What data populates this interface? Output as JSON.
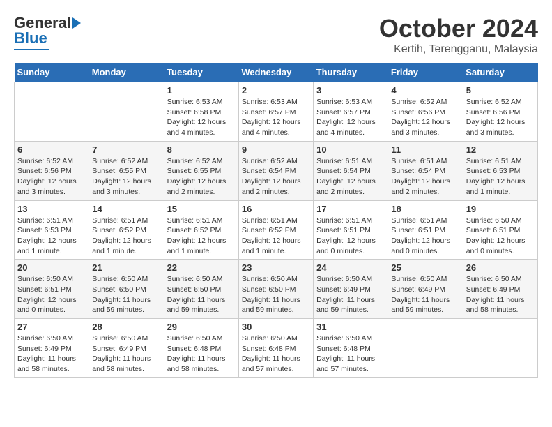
{
  "logo": {
    "line1": "General",
    "line2": "Blue"
  },
  "title": "October 2024",
  "location": "Kertih, Terengganu, Malaysia",
  "days_of_week": [
    "Sunday",
    "Monday",
    "Tuesday",
    "Wednesday",
    "Thursday",
    "Friday",
    "Saturday"
  ],
  "weeks": [
    [
      {
        "day": "",
        "info": ""
      },
      {
        "day": "",
        "info": ""
      },
      {
        "day": "1",
        "info": "Sunrise: 6:53 AM\nSunset: 6:58 PM\nDaylight: 12 hours\nand 4 minutes."
      },
      {
        "day": "2",
        "info": "Sunrise: 6:53 AM\nSunset: 6:57 PM\nDaylight: 12 hours\nand 4 minutes."
      },
      {
        "day": "3",
        "info": "Sunrise: 6:53 AM\nSunset: 6:57 PM\nDaylight: 12 hours\nand 4 minutes."
      },
      {
        "day": "4",
        "info": "Sunrise: 6:52 AM\nSunset: 6:56 PM\nDaylight: 12 hours\nand 3 minutes."
      },
      {
        "day": "5",
        "info": "Sunrise: 6:52 AM\nSunset: 6:56 PM\nDaylight: 12 hours\nand 3 minutes."
      }
    ],
    [
      {
        "day": "6",
        "info": "Sunrise: 6:52 AM\nSunset: 6:56 PM\nDaylight: 12 hours\nand 3 minutes."
      },
      {
        "day": "7",
        "info": "Sunrise: 6:52 AM\nSunset: 6:55 PM\nDaylight: 12 hours\nand 3 minutes."
      },
      {
        "day": "8",
        "info": "Sunrise: 6:52 AM\nSunset: 6:55 PM\nDaylight: 12 hours\nand 2 minutes."
      },
      {
        "day": "9",
        "info": "Sunrise: 6:52 AM\nSunset: 6:54 PM\nDaylight: 12 hours\nand 2 minutes."
      },
      {
        "day": "10",
        "info": "Sunrise: 6:51 AM\nSunset: 6:54 PM\nDaylight: 12 hours\nand 2 minutes."
      },
      {
        "day": "11",
        "info": "Sunrise: 6:51 AM\nSunset: 6:54 PM\nDaylight: 12 hours\nand 2 minutes."
      },
      {
        "day": "12",
        "info": "Sunrise: 6:51 AM\nSunset: 6:53 PM\nDaylight: 12 hours\nand 1 minute."
      }
    ],
    [
      {
        "day": "13",
        "info": "Sunrise: 6:51 AM\nSunset: 6:53 PM\nDaylight: 12 hours\nand 1 minute."
      },
      {
        "day": "14",
        "info": "Sunrise: 6:51 AM\nSunset: 6:52 PM\nDaylight: 12 hours\nand 1 minute."
      },
      {
        "day": "15",
        "info": "Sunrise: 6:51 AM\nSunset: 6:52 PM\nDaylight: 12 hours\nand 1 minute."
      },
      {
        "day": "16",
        "info": "Sunrise: 6:51 AM\nSunset: 6:52 PM\nDaylight: 12 hours\nand 1 minute."
      },
      {
        "day": "17",
        "info": "Sunrise: 6:51 AM\nSunset: 6:51 PM\nDaylight: 12 hours\nand 0 minutes."
      },
      {
        "day": "18",
        "info": "Sunrise: 6:51 AM\nSunset: 6:51 PM\nDaylight: 12 hours\nand 0 minutes."
      },
      {
        "day": "19",
        "info": "Sunrise: 6:50 AM\nSunset: 6:51 PM\nDaylight: 12 hours\nand 0 minutes."
      }
    ],
    [
      {
        "day": "20",
        "info": "Sunrise: 6:50 AM\nSunset: 6:51 PM\nDaylight: 12 hours\nand 0 minutes."
      },
      {
        "day": "21",
        "info": "Sunrise: 6:50 AM\nSunset: 6:50 PM\nDaylight: 11 hours\nand 59 minutes."
      },
      {
        "day": "22",
        "info": "Sunrise: 6:50 AM\nSunset: 6:50 PM\nDaylight: 11 hours\nand 59 minutes."
      },
      {
        "day": "23",
        "info": "Sunrise: 6:50 AM\nSunset: 6:50 PM\nDaylight: 11 hours\nand 59 minutes."
      },
      {
        "day": "24",
        "info": "Sunrise: 6:50 AM\nSunset: 6:49 PM\nDaylight: 11 hours\nand 59 minutes."
      },
      {
        "day": "25",
        "info": "Sunrise: 6:50 AM\nSunset: 6:49 PM\nDaylight: 11 hours\nand 59 minutes."
      },
      {
        "day": "26",
        "info": "Sunrise: 6:50 AM\nSunset: 6:49 PM\nDaylight: 11 hours\nand 58 minutes."
      }
    ],
    [
      {
        "day": "27",
        "info": "Sunrise: 6:50 AM\nSunset: 6:49 PM\nDaylight: 11 hours\nand 58 minutes."
      },
      {
        "day": "28",
        "info": "Sunrise: 6:50 AM\nSunset: 6:49 PM\nDaylight: 11 hours\nand 58 minutes."
      },
      {
        "day": "29",
        "info": "Sunrise: 6:50 AM\nSunset: 6:48 PM\nDaylight: 11 hours\nand 58 minutes."
      },
      {
        "day": "30",
        "info": "Sunrise: 6:50 AM\nSunset: 6:48 PM\nDaylight: 11 hours\nand 57 minutes."
      },
      {
        "day": "31",
        "info": "Sunrise: 6:50 AM\nSunset: 6:48 PM\nDaylight: 11 hours\nand 57 minutes."
      },
      {
        "day": "",
        "info": ""
      },
      {
        "day": "",
        "info": ""
      }
    ]
  ]
}
